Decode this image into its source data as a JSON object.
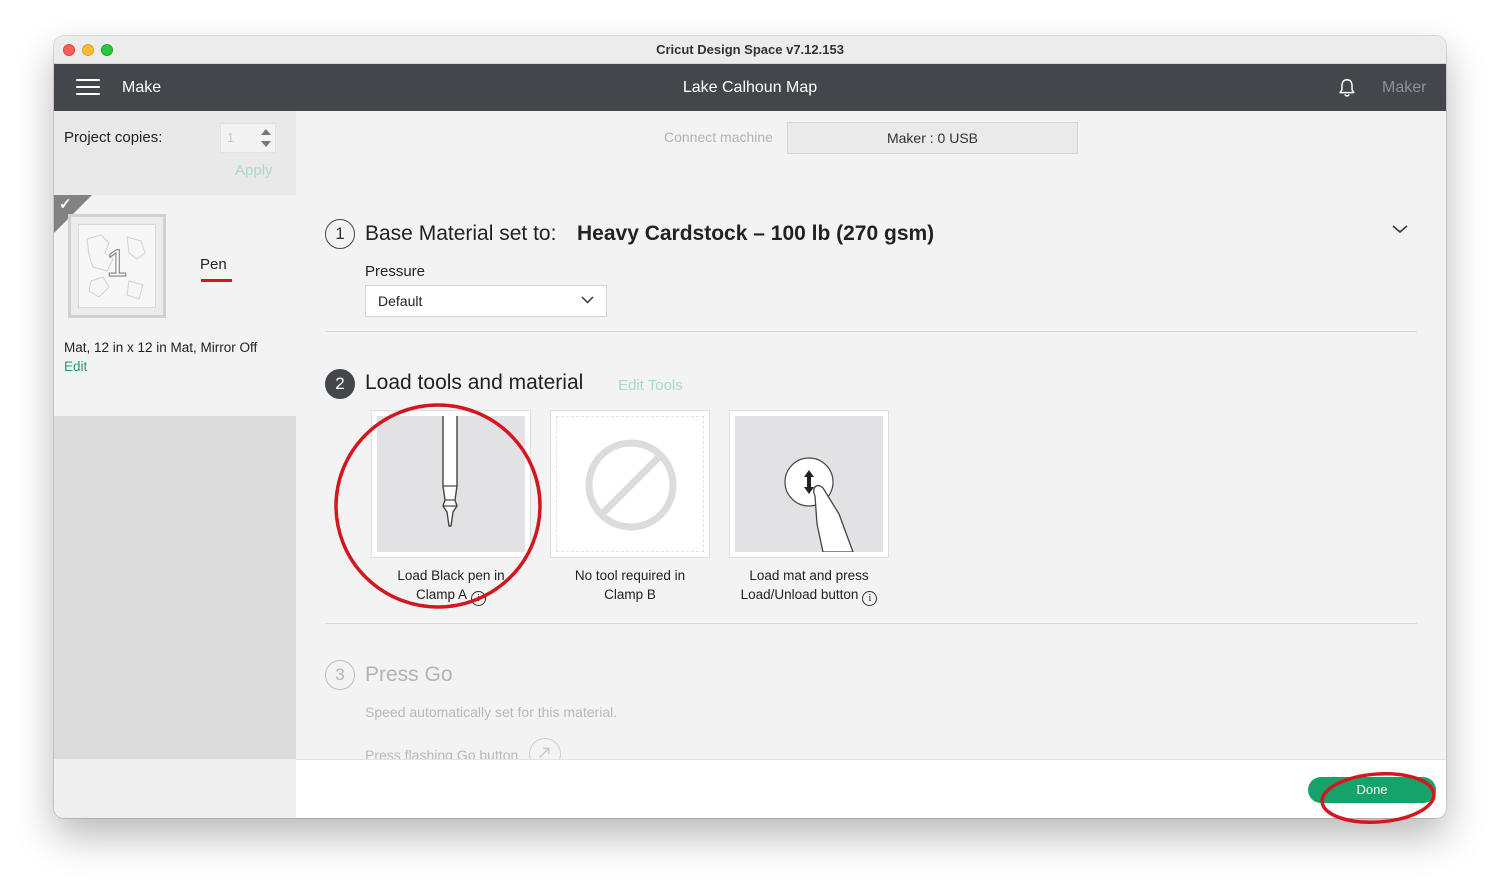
{
  "window": {
    "title": "Cricut Design Space  v7.12.153"
  },
  "header": {
    "mode_label": "Make",
    "project_title": "Lake Calhoun Map",
    "machine_name": "Maker",
    "icons": [
      "hamburger-menu-icon",
      "bell-icon"
    ]
  },
  "sidebar": {
    "copies_label": "Project copies:",
    "copies_value": "1",
    "apply_label": "Apply",
    "mat": {
      "number": "1",
      "tool_label": "Pen",
      "description": "Mat, 12 in x 12 in Mat, Mirror Off",
      "edit_label": "Edit"
    }
  },
  "connection": {
    "label": "Connect machine",
    "machine_value": "Maker : 0 USB"
  },
  "steps": {
    "step1": {
      "number": "1",
      "label": "Base Material set to:",
      "material": "Heavy Cardstock – 100 lb (270 gsm)",
      "pressure_label": "Pressure",
      "pressure_value": "Default"
    },
    "step2": {
      "number": "2",
      "label": "Load tools and material",
      "edit_tools_label": "Edit Tools",
      "cards": [
        {
          "line1": "Load Black pen in",
          "line2": "Clamp A",
          "icon": "pen-icon"
        },
        {
          "line1": "No tool required in",
          "line2": "Clamp B",
          "icon": "no-tool-icon"
        },
        {
          "line1": "Load mat and press",
          "line2": "Load/Unload button",
          "icon": "load-unload-icon"
        }
      ]
    },
    "step3": {
      "number": "3",
      "label": "Press Go",
      "sublabel": "Speed automatically set for this material.",
      "go_text": "Press flashing Go button"
    }
  },
  "footer": {
    "done_label": "Done"
  },
  "colors": {
    "header_bg": "#43464b",
    "accent_green": "#16a36b",
    "annotation_red": "#d4161f"
  }
}
